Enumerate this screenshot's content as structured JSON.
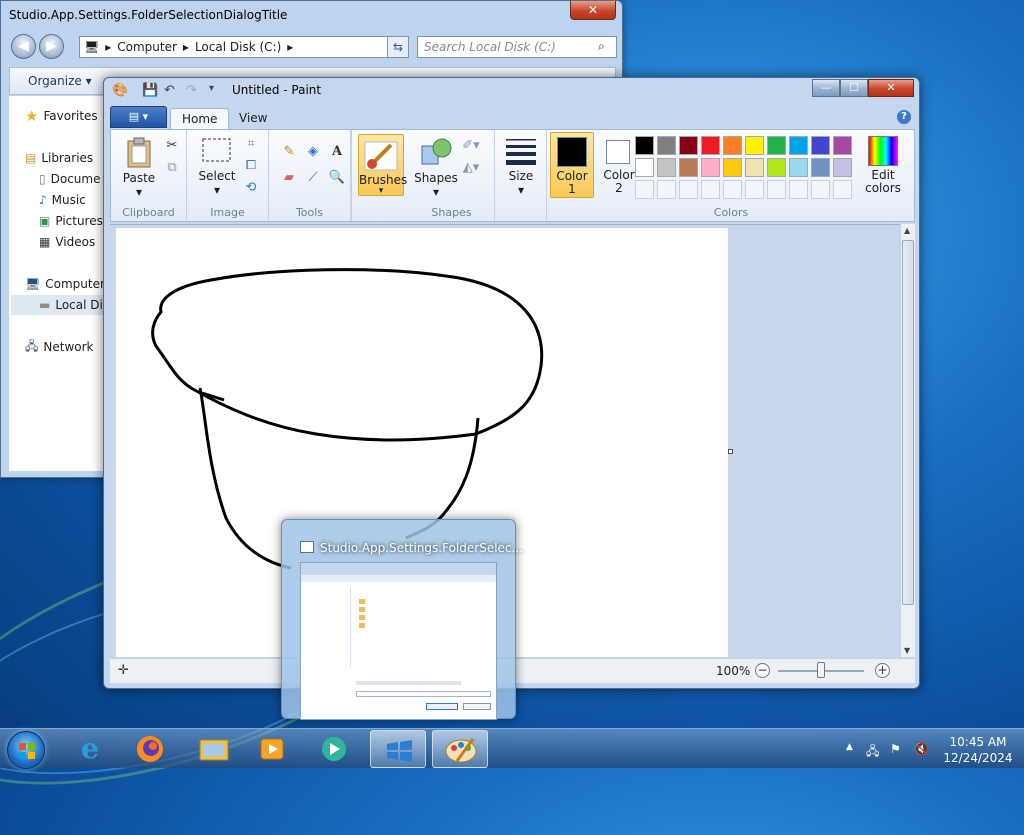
{
  "explorer": {
    "title": "Studio.App.Settings.FolderSelectionDialogTitle",
    "close_label": "✕",
    "address": [
      "Computer",
      "Local Disk (C:)"
    ],
    "search_placeholder": "Search Local Disk (C:)",
    "organize_label": "Organize",
    "nav": {
      "favorites": "Favorites",
      "libraries": "Libraries",
      "documents": "Docume",
      "music": "Music",
      "pictures": "Pictures",
      "videos": "Videos",
      "computer": "Computer",
      "local_disk": "Local Di",
      "network": "Network"
    }
  },
  "paint": {
    "title": "Untitled - Paint",
    "tabs": {
      "home": "Home",
      "view": "View"
    },
    "ribbon": {
      "clipboard": {
        "label": "Clipboard",
        "paste": "Paste"
      },
      "image": {
        "label": "Image",
        "select": "Select"
      },
      "tools": {
        "label": "Tools"
      },
      "brushes": "Brushes",
      "shapes": {
        "label": "Shapes",
        "button": "Shapes"
      },
      "size": "Size",
      "color1": {
        "line1": "Color",
        "line2": "1",
        "value": "#000000"
      },
      "color2": {
        "line1": "Color",
        "line2": "2",
        "value": "#ffffff"
      },
      "colors_label": "Colors",
      "edit_colors": {
        "line1": "Edit",
        "line2": "colors"
      },
      "palette_row1": [
        "#000000",
        "#7f7f7f",
        "#880015",
        "#ed1c24",
        "#ff7f27",
        "#fff200",
        "#22b14c",
        "#00a2e8",
        "#3f48cc",
        "#a349a4"
      ],
      "palette_row2": [
        "#ffffff",
        "#c3c3c3",
        "#b97a57",
        "#ffaec9",
        "#ffc90e",
        "#efe4b0",
        "#b5e61d",
        "#99d9ea",
        "#7092be",
        "#c8bfe7"
      ]
    },
    "status": {
      "zoom": "100%"
    }
  },
  "thumbnail": {
    "title": "Studio.App.Settings.FolderSelec..."
  },
  "taskbar": {
    "time": "10:45 AM",
    "date": "12/24/2024"
  }
}
